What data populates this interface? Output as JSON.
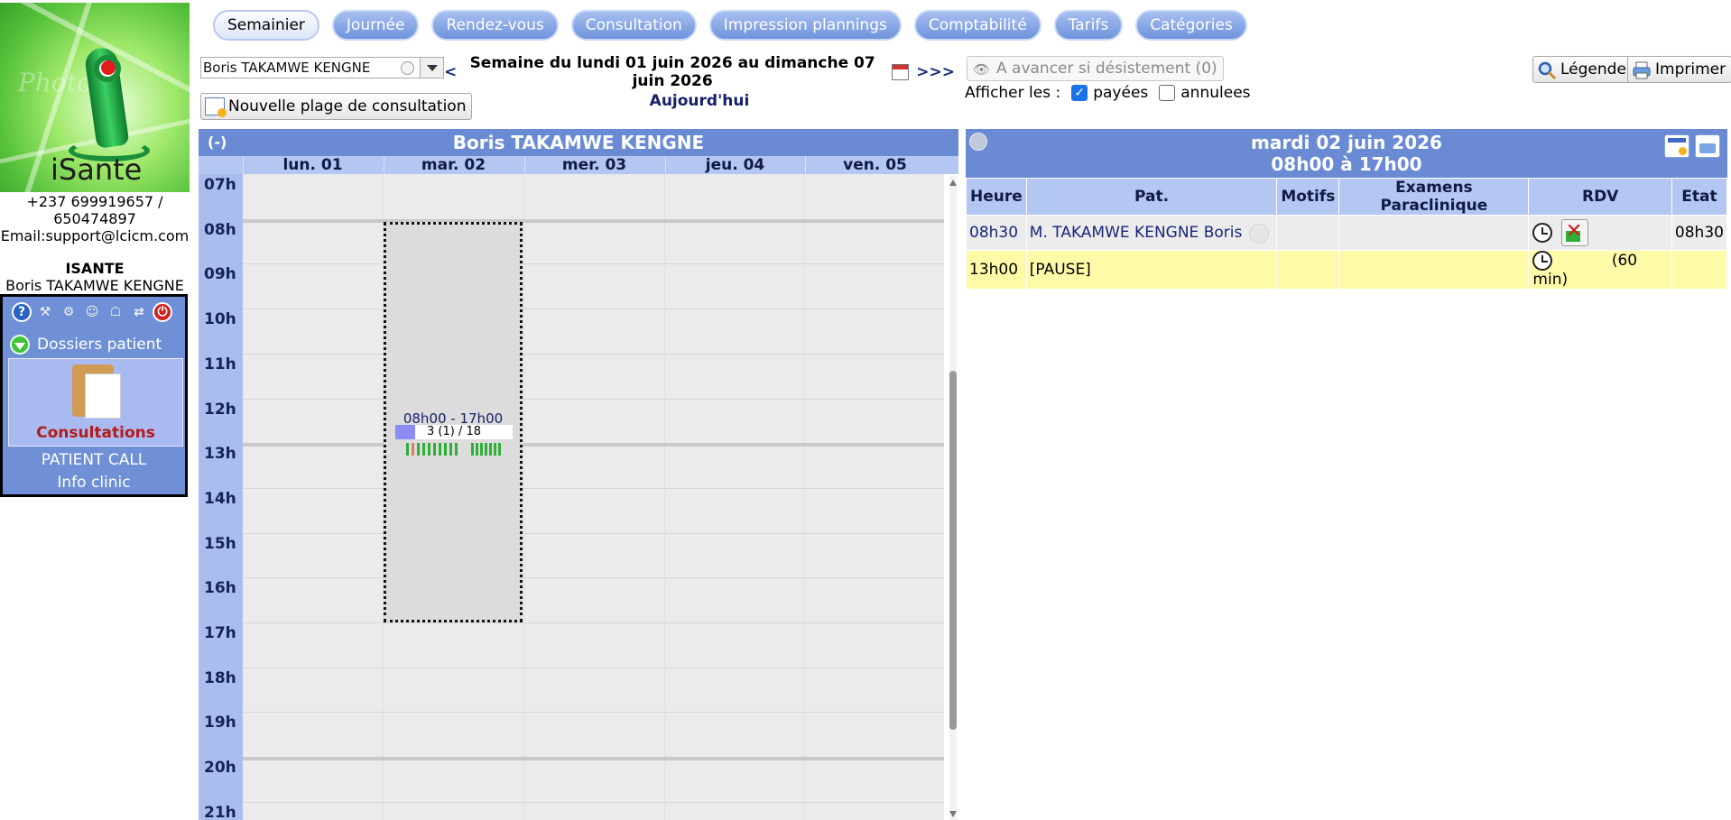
{
  "sidebar": {
    "logo_watermark": "Photos",
    "logo_brand": "iSante",
    "contact_line1": "+237 699919657 /",
    "contact_line2": "650474897",
    "contact_line3": "Email:support@lcicm.com",
    "org_name": "ISANTE",
    "user_name": "Boris TAKAMWE KENGNE",
    "tools": [
      "help-icon",
      "settings-icon",
      "tools-icon",
      "user-icon",
      "lock-icon",
      "switch-icon",
      "power-icon"
    ],
    "section_label": "Dossiers patient",
    "consultations_label": "Consultations",
    "patient_call_label": "PATIENT CALL",
    "info_clinic_label": "Info clinic"
  },
  "tabs": [
    {
      "label": "Semainier",
      "active": true
    },
    {
      "label": "Journée"
    },
    {
      "label": "Rendez-vous"
    },
    {
      "label": "Consultation"
    },
    {
      "label": "Impression plannings"
    },
    {
      "label": "Comptabilité"
    },
    {
      "label": "Tarifs"
    },
    {
      "label": "Catégories"
    }
  ],
  "controls": {
    "praticien_selected": "Boris TAKAMWE KENGNE",
    "week_prev": "<",
    "week_label": "Semaine du lundi 01 juin 2026 au dimanche 07 juin 2026",
    "week_next": ">>>",
    "today_label": "Aujourd'hui",
    "new_slot_label": "Nouvelle plage de consultation",
    "avancer_label": "A avancer si désistement (0)",
    "afficher_label": "Afficher les :",
    "payees_label": "payées",
    "payees_checked": true,
    "annulees_label": "annulees",
    "annulees_checked": false,
    "legend_label": "Légende",
    "print_label": "Imprimer"
  },
  "planner": {
    "collapse_label": "(-)",
    "title": "Boris TAKAMWE KENGNE",
    "days": [
      "lun. 01",
      "mar. 02",
      "mer. 03",
      "jeu. 04",
      "ven. 05"
    ],
    "hours": [
      "07h",
      "08h",
      "09h",
      "10h",
      "11h",
      "12h",
      "13h",
      "14h",
      "15h",
      "16h",
      "17h",
      "18h",
      "19h",
      "20h",
      "21h"
    ],
    "slot": {
      "day": "mar. 02",
      "time_range": "08h00 - 17h00",
      "count_label": "3 (1) / 18",
      "filled_fraction": 0.17
    }
  },
  "day_panel": {
    "title": "mardi 02 juin 2026",
    "subtitle": "08h00 à 17h00",
    "columns": [
      "Heure",
      "Pat.",
      "Motifs",
      "Examens Paraclinique",
      "RDV",
      "Etat"
    ],
    "rows": [
      {
        "heure": "08h30",
        "patient": "M. TAKAMWE KENGNE Boris",
        "motifs": "",
        "examens": "",
        "rdv_extra": "",
        "etat": "08h30"
      },
      {
        "heure": "13h00",
        "patient": "[PAUSE]",
        "motifs": "",
        "examens": "",
        "rdv_extra": "(60 min)",
        "etat": ""
      }
    ]
  }
}
